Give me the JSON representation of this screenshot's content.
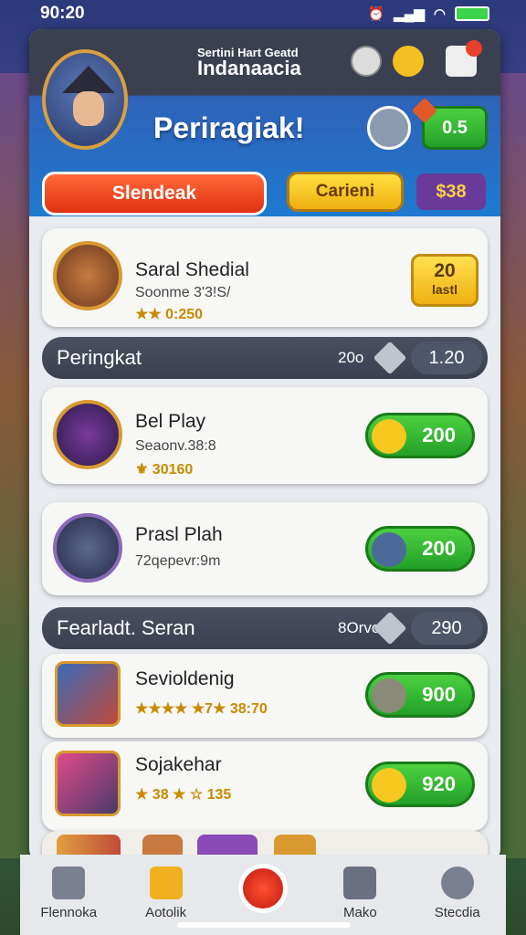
{
  "status": {
    "time": "90:20"
  },
  "header": {
    "small_title": "Sertini Hart Geatd",
    "title": "Indanaacia",
    "welcome": "Periragiak!",
    "coins": "0.5",
    "primary_button": "Slendeak",
    "secondary_button": "Carieni",
    "gem_count": "$38"
  },
  "cards": {
    "featured": {
      "name": "Saral Shedial",
      "subtitle": "Soonme 3'3!S/",
      "rating": "★★ 0:250",
      "box_top": "20",
      "box_bottom": "lastl"
    }
  },
  "section1": {
    "title": "Peringkat",
    "count": "20o",
    "pill": "1.20"
  },
  "list1": [
    {
      "name": "Bel Play",
      "subtitle": "Seaonv.38:8",
      "extra": "⚜ 30160",
      "value": "200"
    },
    {
      "name": "Prasl Plah",
      "subtitle": "72qepevr:9m",
      "value": "200"
    }
  ],
  "section2": {
    "title": "Fearladt. Seran",
    "count": "8Orvo",
    "pill": "290"
  },
  "list2": [
    {
      "name": "Sevioldenig",
      "rating": "★★★★ ★7★ 38:70",
      "value": "900"
    },
    {
      "name": "Sojakehar",
      "rating": "★ 38 ★ ☆ 135",
      "value": "920"
    }
  ],
  "tabs": [
    {
      "label": "Flennoka"
    },
    {
      "label": "Aotolik"
    },
    {
      "label": ""
    },
    {
      "label": "Mako"
    },
    {
      "label": "Stecdia"
    }
  ],
  "colors": {
    "accent_green": "#23a028",
    "accent_red": "#e03010",
    "accent_yellow": "#f0b010"
  }
}
